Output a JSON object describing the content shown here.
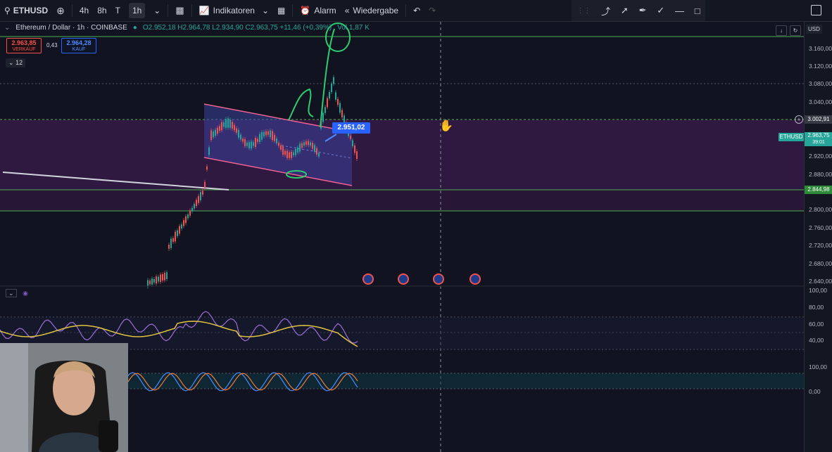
{
  "toolbar": {
    "symbol": "ETHUSD",
    "intervals": [
      "4h",
      "8h",
      "T",
      "1h"
    ],
    "active_interval": "1h",
    "indicators_label": "Indikatoren",
    "alarm_label": "Alarm",
    "replay_label": "Wiedergabe"
  },
  "legend": {
    "title": "Ethereum / Dollar · 1h · COINBASE",
    "ohlc": "O2.952,18 H2.964,78 L2.934,90 C2.963,75 +11,46 (+0,39%)",
    "volume": "Vol 1,87 K"
  },
  "trade": {
    "sell_price": "2.963,85",
    "sell_label": "VERKAUF",
    "spread": "0,43",
    "buy_price": "2.964,28",
    "buy_label": "KAUF"
  },
  "interval_badge": "12",
  "drag_tooltip": "2.951,02",
  "currency": "USD",
  "price_axis": {
    "labels": [
      "3.160,00",
      "3.120,00",
      "3.080,00",
      "3.040,00",
      "2.920,00",
      "2.880,00",
      "2.800,00",
      "2.760,00",
      "2.720,00",
      "2.680,00",
      "2.640,00"
    ],
    "crosshair_price": "3.002,91",
    "current_symbol": "ETHUSD",
    "current_price": "2.963,75",
    "countdown": "39:01",
    "level_price": "2.844,98"
  },
  "rsi_axis": [
    "100,00",
    "80,00",
    "60,00",
    "40,00"
  ],
  "stoch_axis": [
    "100,00",
    "0,00"
  ],
  "colors": {
    "up": "#26a69a",
    "down": "#ef5350",
    "zone": "#3b1a4a",
    "channel": "#3a3f9a",
    "level_line": "#4caf50",
    "drawing": "#2ecc71"
  }
}
